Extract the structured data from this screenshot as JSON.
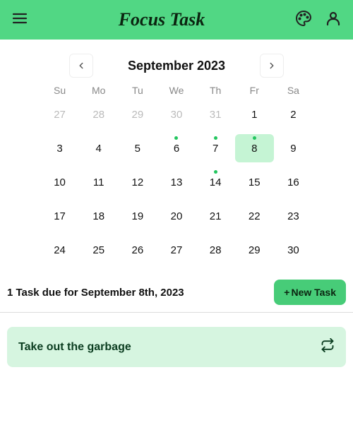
{
  "header": {
    "title": "Focus Task"
  },
  "calendar": {
    "month_label": "September 2023",
    "weekdays": [
      "Su",
      "Mo",
      "Tu",
      "We",
      "Th",
      "Fr",
      "Sa"
    ],
    "days": [
      {
        "n": 27,
        "muted": true
      },
      {
        "n": 28,
        "muted": true
      },
      {
        "n": 29,
        "muted": true
      },
      {
        "n": 30,
        "muted": true
      },
      {
        "n": 31,
        "muted": true
      },
      {
        "n": 1
      },
      {
        "n": 2
      },
      {
        "n": 3
      },
      {
        "n": 4
      },
      {
        "n": 5
      },
      {
        "n": 6,
        "dot": true
      },
      {
        "n": 7,
        "dot": true
      },
      {
        "n": 8,
        "dot": true,
        "selected": true
      },
      {
        "n": 9
      },
      {
        "n": 10
      },
      {
        "n": 11
      },
      {
        "n": 12
      },
      {
        "n": 13
      },
      {
        "n": 14,
        "dot": true
      },
      {
        "n": 15
      },
      {
        "n": 16
      },
      {
        "n": 17
      },
      {
        "n": 18
      },
      {
        "n": 19
      },
      {
        "n": 20
      },
      {
        "n": 21
      },
      {
        "n": 22
      },
      {
        "n": 23
      },
      {
        "n": 24
      },
      {
        "n": 25
      },
      {
        "n": 26
      },
      {
        "n": 27
      },
      {
        "n": 28
      },
      {
        "n": 29
      },
      {
        "n": 30
      }
    ]
  },
  "task_section": {
    "heading": "1 Task due for September 8th, 2023",
    "new_task_label": "New Task"
  },
  "tasks": [
    {
      "title": "Take out the garbage"
    }
  ]
}
